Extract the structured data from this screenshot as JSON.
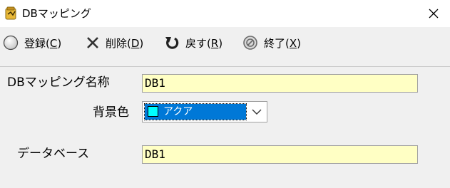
{
  "window": {
    "title": "DBマッピング",
    "close_icon": "close-icon"
  },
  "toolbar": {
    "register_label": "登録(",
    "register_key": "C",
    "register_close": ")",
    "delete_label": "削除(",
    "delete_key": "D",
    "delete_close": ")",
    "back_label": "戻す(",
    "back_key": "R",
    "back_close": ")",
    "exit_label": "終了(",
    "exit_key": "X",
    "exit_close": ")"
  },
  "form": {
    "mapping_name_label": "DBマッピング名称",
    "mapping_name_value": "DB1",
    "bg_color_label": "背景色",
    "bg_color_value": "アクア",
    "bg_color_swatch": "#00ffff",
    "database_label": "データベース",
    "database_value": "DB1"
  },
  "colors": {
    "field_bg": "#ffffc4",
    "selection": "#0078d7"
  }
}
